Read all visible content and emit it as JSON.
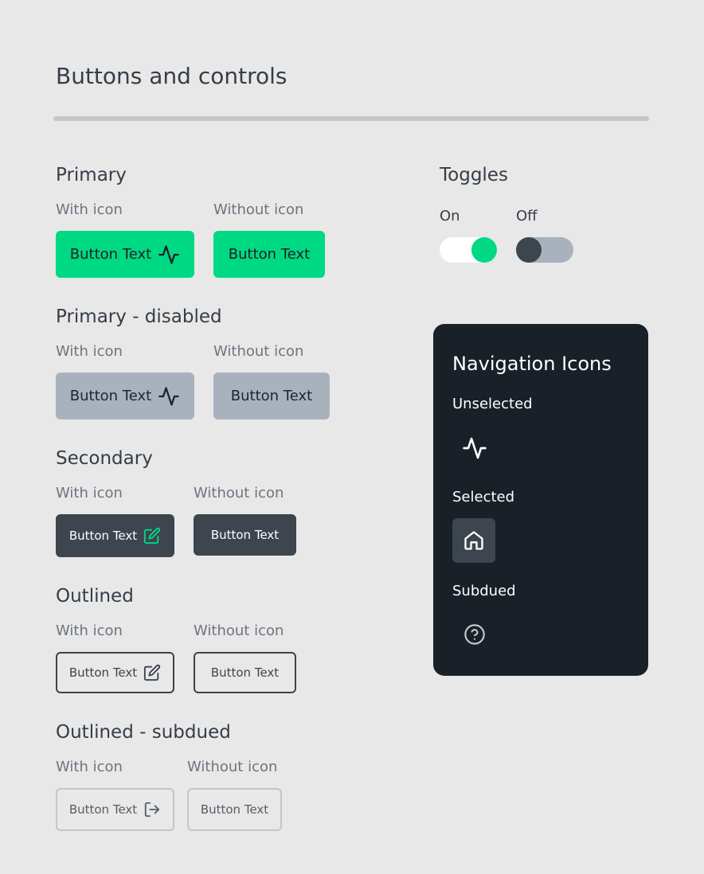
{
  "page": {
    "title": "Buttons and controls"
  },
  "sections": {
    "primary": {
      "heading": "Primary",
      "with_icon": "With icon",
      "without_icon": "Without icon",
      "btn_icon_label": "Button Text",
      "btn_label": "Button Text"
    },
    "primary_disabled": {
      "heading": "Primary - disabled",
      "with_icon": "With icon",
      "without_icon": "Without icon",
      "btn_icon_label": "Button Text",
      "btn_label": "Button Text"
    },
    "secondary": {
      "heading": "Secondary",
      "with_icon": "With icon",
      "without_icon": "Without icon",
      "btn_icon_label": "Button Text",
      "btn_label": "Button Text"
    },
    "outlined": {
      "heading": "Outlined",
      "with_icon": "With icon",
      "without_icon": "Without icon",
      "btn_icon_label": "Button Text",
      "btn_label": "Button Text"
    },
    "outlined_subdued": {
      "heading": "Outlined - subdued",
      "with_icon": "With icon",
      "without_icon": "Without icon",
      "btn_icon_label": "Button Text",
      "btn_label": "Button Text"
    }
  },
  "toggles": {
    "heading": "Toggles",
    "on_label": "On",
    "off_label": "Off"
  },
  "navigation": {
    "title": "Navigation Icons",
    "unselected_label": "Unselected",
    "selected_label": "Selected",
    "subdued_label": "Subdued",
    "icons": {
      "unselected": "activity-icon",
      "selected": "home-icon",
      "subdued": "help-circle-icon"
    }
  },
  "colors": {
    "background": "#e8e8e8",
    "primary_green": "#00d983",
    "disabled_gray": "#a8b2bd",
    "secondary_dark": "#3d454e",
    "panel_dark": "#1a2028"
  }
}
